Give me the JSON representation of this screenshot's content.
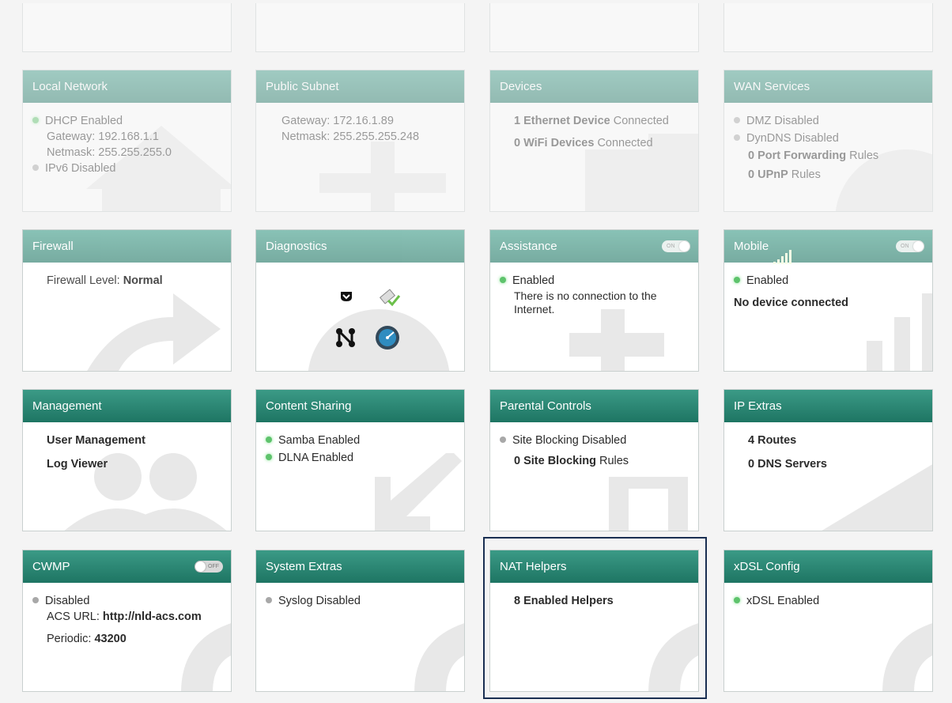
{
  "cards": {
    "local_network": {
      "title": "Local Network",
      "dhcp": "DHCP Enabled",
      "gateway": "Gateway: 192.168.1.1",
      "netmask": "Netmask: 255.255.255.0",
      "ipv6": "IPv6 Disabled"
    },
    "public_subnet": {
      "title": "Public Subnet",
      "gateway": "Gateway: 172.16.1.89",
      "netmask": "Netmask: 255.255.255.248"
    },
    "devices": {
      "title": "Devices",
      "ethernet_count": "1 Ethernet Device",
      "ethernet_suffix": " Connected",
      "wifi_count": "0 WiFi Devices",
      "wifi_suffix": " Connected"
    },
    "wan_services": {
      "title": "WAN Services",
      "dmz": "DMZ Disabled",
      "dyndns": "DynDNS Disabled",
      "port_fwd_bold": "0 Port Forwarding",
      "port_fwd_suffix": " Rules",
      "upnp_bold": "0 UPnP",
      "upnp_suffix": " Rules"
    },
    "firewall": {
      "title": "Firewall",
      "level_label": "Firewall Level: ",
      "level_value": "Normal"
    },
    "diagnostics": {
      "title": "Diagnostics"
    },
    "assistance": {
      "title": "Assistance",
      "toggle": "ON",
      "status": "Enabled",
      "message": "There is no connection to the Internet."
    },
    "mobile": {
      "title": "Mobile",
      "toggle": "ON",
      "status": "Enabled",
      "device": "No device connected"
    },
    "management": {
      "title": "Management",
      "user_mgmt": "User Management",
      "log_viewer": "Log Viewer"
    },
    "content_sharing": {
      "title": "Content Sharing",
      "samba": "Samba Enabled",
      "dlna": "DLNA Enabled"
    },
    "parental_controls": {
      "title": "Parental Controls",
      "site_blocking": "Site Blocking Disabled",
      "rules_count": "0 Site Blocking",
      "rules_suffix": " Rules"
    },
    "ip_extras": {
      "title": "IP Extras",
      "routes": "4 Routes",
      "dns": "0 DNS Servers"
    },
    "cwmp": {
      "title": "CWMP",
      "toggle": "OFF",
      "status": "Disabled",
      "acs_label": "ACS URL: ",
      "acs_value": "http://nld-acs.com",
      "periodic_label": "Periodic: ",
      "periodic_value": "43200"
    },
    "system_extras": {
      "title": "System Extras",
      "syslog": "Syslog Disabled"
    },
    "nat_helpers": {
      "title": "NAT Helpers",
      "helpers": "8 Enabled Helpers"
    },
    "xdsl_config": {
      "title": "xDSL Config",
      "status": "xDSL Enabled"
    }
  },
  "colors": {
    "header": "#1e7563",
    "enabled_dot": "#5ec36c",
    "disabled_dot": "#a8a8a8",
    "selection": "#1a2f52"
  }
}
